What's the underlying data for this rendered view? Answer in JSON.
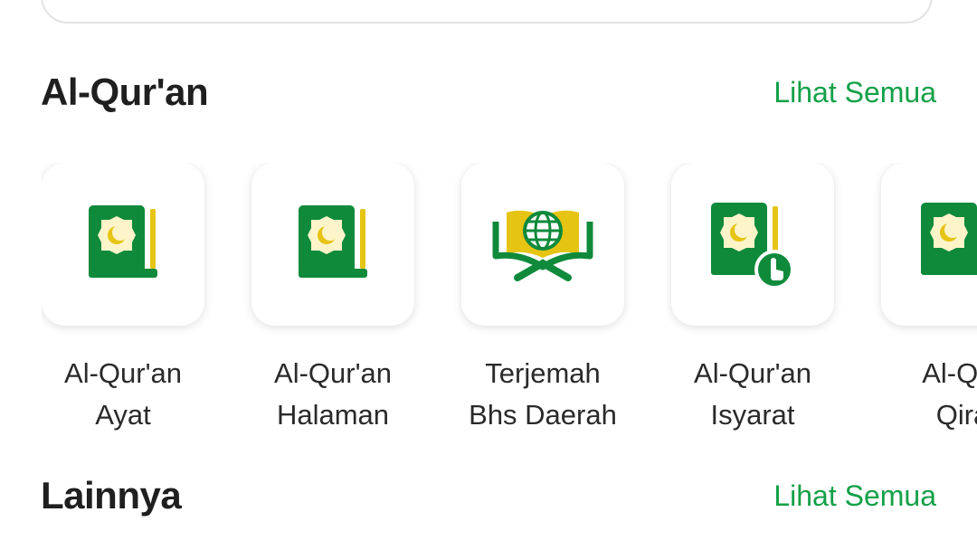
{
  "sections": {
    "quran": {
      "title": "Al-Qur'an",
      "see_all": "Lihat Semua",
      "items": [
        {
          "line1": "Al-Qur'an",
          "line2": "Ayat",
          "icon": "quran-book-icon"
        },
        {
          "line1": "Al-Qur'an",
          "line2": "Halaman",
          "icon": "quran-book-icon"
        },
        {
          "line1": "Terjemah",
          "line2": "Bhs Daerah",
          "icon": "quran-globe-icon"
        },
        {
          "line1": "Al-Qur'an",
          "line2": "Isyarat",
          "icon": "quran-sign-language-icon"
        },
        {
          "line1": "Al-Qur",
          "line2": "Qira",
          "icon": "quran-book-icon"
        }
      ]
    },
    "others": {
      "title": "Lainnya",
      "see_all": "Lihat Semua"
    }
  },
  "colors": {
    "accent_green": "#14a048",
    "icon_green": "#0f8a3b",
    "icon_yellow": "#e6c414"
  }
}
